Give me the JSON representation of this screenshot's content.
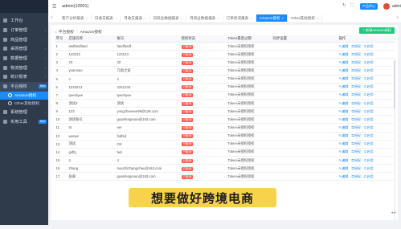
{
  "topbar": {
    "account": "admin(10001)",
    "product_center": "产品中心",
    "username": "admin"
  },
  "sidebar": {
    "items": [
      {
        "label": "工作台"
      },
      {
        "label": "订单管理"
      },
      {
        "label": "商品管理"
      },
      {
        "label": "采购管理"
      },
      {
        "label": "数据管理"
      },
      {
        "label": "物流管理"
      },
      {
        "label": "统计报表"
      },
      {
        "label": "平台授权",
        "tag": "New"
      }
    ],
    "subitems": [
      {
        "label": "Amazon授权"
      },
      {
        "label": "Other其他授权"
      }
    ],
    "bottom_items": [
      {
        "label": "系统管理"
      },
      {
        "label": "实用工具",
        "tag": "New"
      }
    ]
  },
  "tabs": [
    "客户分析报表",
    "日收支报表",
    "月收支报表",
    "日商业数据报表",
    "月商业数据报表",
    "订单状况报表",
    "Amazon授权",
    "Other其他授权"
  ],
  "active_tab": 6,
  "panel": {
    "title": "平台授权",
    "crumb": "Amazon授权",
    "add_button": "+ 新增Amazon授权"
  },
  "table": {
    "columns": [
      "序号",
      "店铺名称",
      "账号",
      "授权状态",
      "Token最后过期",
      "同步设置",
      "操作"
    ],
    "status_text": "已取消",
    "token_text": "Token未授权授权",
    "ops": [
      "编辑",
      "授权",
      "启用"
    ],
    "rows": [
      [
        "1",
        "asdfasdfasd",
        "fasdfasdf"
      ],
      [
        "2",
        "123312",
        "123123"
      ],
      [
        "3",
        "23",
        "32"
      ],
      [
        "4",
        "yuanxiao",
        "元雨之家"
      ],
      [
        "5",
        "ri",
        "ri"
      ],
      [
        "6",
        "1234213",
        "2341234"
      ],
      [
        "7",
        "tyeertyee",
        "tyeertyee"
      ],
      [
        "8",
        "测试2",
        "测试"
      ],
      [
        "9",
        "123",
        "yongzheeeee99@126.com"
      ],
      [
        "10",
        "测试账号",
        "guanfengsoun@163.com"
      ],
      [
        "11",
        "ttr",
        "eer"
      ],
      [
        "12",
        "werwe",
        "fsdfsd"
      ],
      [
        "13",
        "测试",
        "OK"
      ],
      [
        "14",
        "gsffg",
        "fed"
      ],
      [
        "15",
        "4",
        "4"
      ],
      [
        "16",
        "zhang",
        "maozhizhangchao@163.com"
      ],
      [
        "17",
        "张翠",
        "guanfengsoun@163.com"
      ]
    ]
  },
  "subtitle": "想要做好跨境电商"
}
